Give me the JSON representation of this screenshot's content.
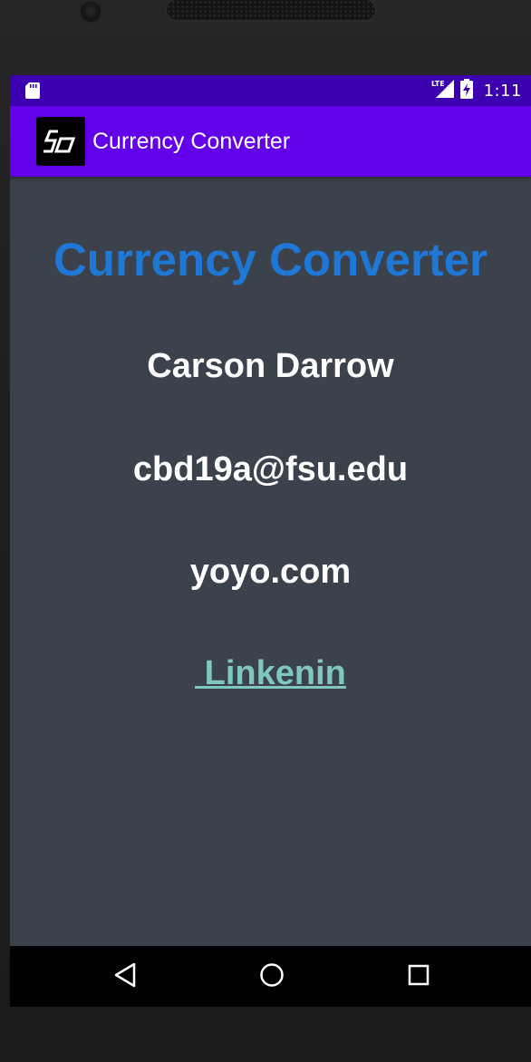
{
  "status_bar": {
    "time": "1:11",
    "network": "LTE",
    "icons": [
      "sd-card-icon",
      "lte-signal-icon",
      "battery-charging-icon"
    ]
  },
  "app_bar": {
    "title": "Currency Converter",
    "logo_icon": "cd-logo-icon"
  },
  "content": {
    "title": "Currency Converter",
    "name": "Carson Darrow",
    "email": "cbd19a@fsu.edu",
    "website": "yoyo.com",
    "linkedin_label": " Linkenin"
  },
  "nav_bar": {
    "icons": [
      "back-icon",
      "home-icon",
      "recents-icon"
    ]
  },
  "colors": {
    "status_bar": "#3d00b0",
    "app_bar": "#6200ea",
    "background": "#3c424b",
    "title": "#1f77d6",
    "link": "#7ec8c0",
    "text": "#ffffff"
  }
}
